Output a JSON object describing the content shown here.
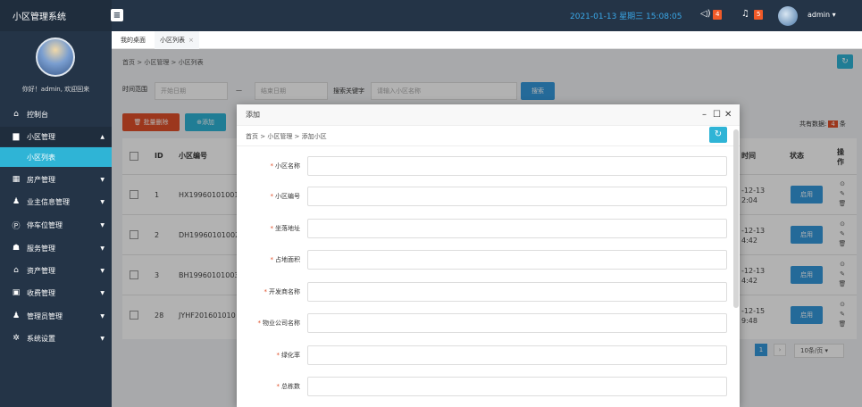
{
  "app": {
    "title": "小区管理系统"
  },
  "topbar": {
    "menu_toggle": "≡",
    "datetime": "2021-01-13 星期三 15:08:05",
    "notice_icon": "speaker-icon",
    "notice_count": "4",
    "bell_count": "5",
    "user": "admin"
  },
  "sidebar": {
    "welcome": "你好！admin, 欢迎回来",
    "items": [
      {
        "icon": "⌂",
        "label": "控制台"
      },
      {
        "icon": "▆",
        "label": "小区管理"
      },
      {
        "icon": "",
        "label": "小区列表"
      },
      {
        "icon": "▦",
        "label": "房产管理"
      },
      {
        "icon": "♟",
        "label": "业主信息管理"
      },
      {
        "icon": "Ⓟ",
        "label": "停车位管理"
      },
      {
        "icon": "☗",
        "label": "服务管理"
      },
      {
        "icon": "⌂",
        "label": "资产管理"
      },
      {
        "icon": "▣",
        "label": "收费管理"
      },
      {
        "icon": "♟",
        "label": "管理员管理"
      },
      {
        "icon": "✲",
        "label": "系统设置"
      }
    ]
  },
  "tabs": [
    {
      "label": "我的桌面"
    },
    {
      "label": "小区列表",
      "close": "×"
    }
  ],
  "main": {
    "breadcrumb": "首页 > 小区管理 > 小区列表",
    "filter_label": "时间范围",
    "start_placeholder": "开始日期",
    "end_placeholder": "结束日期",
    "range_sep": "—",
    "keyword_label": "搜索关键字",
    "keyword_placeholder": "请输入小区名称",
    "search_label": "搜索",
    "delete_label": "批量删除",
    "add_label": "添加",
    "total_prefix": "共有数据:",
    "total_count": "4",
    "total_suffix": "条",
    "columns": {
      "id": "ID",
      "code": "小区编号",
      "time": "时间",
      "status": "状态",
      "ops": "操作"
    },
    "rows": [
      {
        "id": "1",
        "code": "HX19960101001",
        "time1": "-12-13",
        "time2": "2:04",
        "btn": "启用"
      },
      {
        "id": "2",
        "code": "DH19960101002",
        "time1": "-12-13",
        "time2": "4:42",
        "btn": "启用"
      },
      {
        "id": "3",
        "code": "BH19960101003",
        "time1": "-12-13",
        "time2": "4:42",
        "btn": "启用"
      },
      {
        "id": "28",
        "code": "JYHF201601010",
        "time1": "-12-15",
        "time2": "9:48",
        "btn": "启用"
      }
    ],
    "pager": {
      "page": "1",
      "size": "10条/页"
    }
  },
  "modal": {
    "title": "添加",
    "breadcrumb": "首页 > 小区管理 > 添加小区",
    "fields": [
      {
        "label": "小区名称"
      },
      {
        "label": "小区编号"
      },
      {
        "label": "坐落地址"
      },
      {
        "label": "占地面积"
      },
      {
        "label": "开发商名称"
      },
      {
        "label": "物业公司名称"
      },
      {
        "label": "绿化率"
      },
      {
        "label": "总栋数"
      }
    ]
  }
}
